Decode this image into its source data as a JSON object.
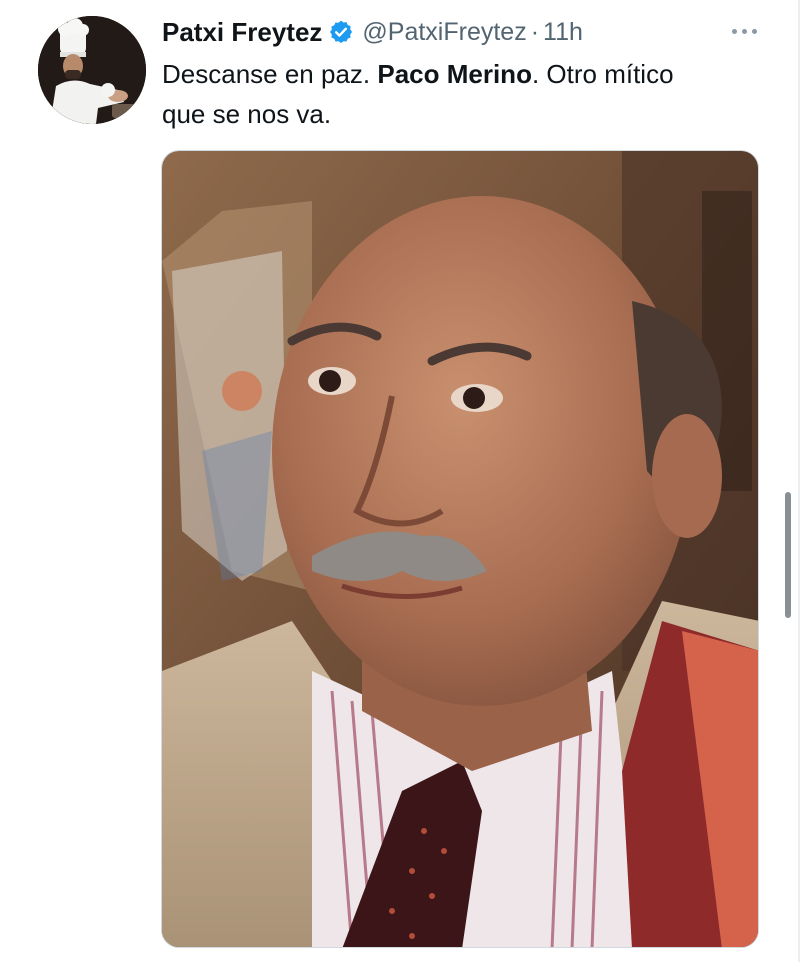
{
  "tweet": {
    "author_name": "Patxi Freytez",
    "handle": "@PatxiFreytez",
    "separator": "·",
    "time": "11h",
    "text_part1": "Descanse en paz. ",
    "text_bold": "Paco Merino",
    "text_part2": ". Otro mítico que se nos va."
  },
  "icons": {
    "verified": "verified-badge-icon",
    "more": "more-options-icon"
  },
  "colors": {
    "verified_blue": "#1d9bf0",
    "text_primary": "#0f1419",
    "text_secondary": "#536471"
  }
}
